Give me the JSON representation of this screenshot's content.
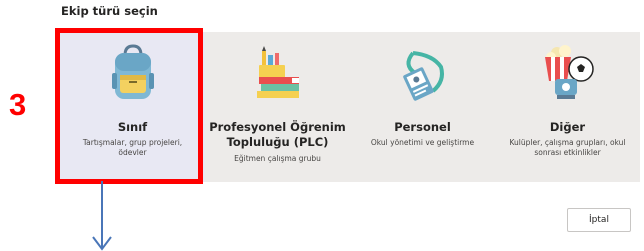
{
  "dialog": {
    "heading": "Ekip türü seçin"
  },
  "cards": [
    {
      "title": "Sınıf",
      "description": "Tartışmalar, grup projeleri, ödevler",
      "icon": "backpack-icon"
    },
    {
      "title": "Profesyonel Öğrenim Topluluğu (PLC)",
      "description": "Eğitmen çalışma grubu",
      "icon": "books-pencils-icon"
    },
    {
      "title": "Personel",
      "description": "Okul yönetimi ve geliştirme",
      "icon": "badge-lanyard-icon"
    },
    {
      "title": "Diğer",
      "description": "Kulüpler, çalışma grupları, okul sonrası etkinlikler",
      "icon": "popcorn-soccer-icon"
    }
  ],
  "annotation": {
    "step_number": "3",
    "color": "#ff0000"
  },
  "footer": {
    "cancel_label": "İptal"
  },
  "colors": {
    "card_bg": "#edebe9",
    "card_selected_bg": "#e8e8f3",
    "accent_red": "#ff0000"
  }
}
